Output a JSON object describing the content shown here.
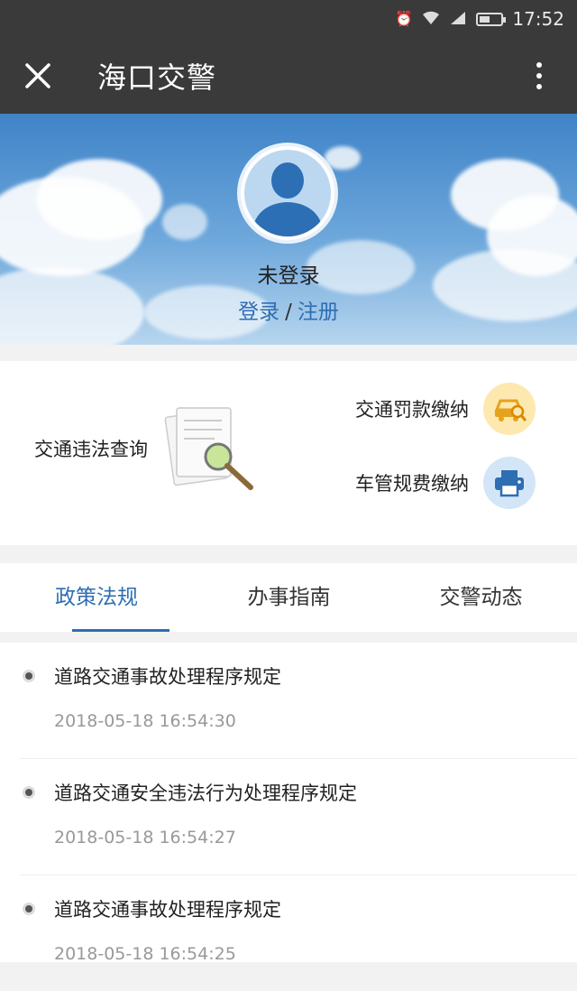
{
  "status_bar": {
    "time": "17:52",
    "battery_level": 0.5
  },
  "header": {
    "title": "海口交警"
  },
  "profile": {
    "status": "未登录",
    "login": "登录",
    "separator": "/",
    "register": "注册"
  },
  "services": {
    "violation_query": "交通违法查询",
    "traffic_fine": "交通罚款缴纳",
    "vehicle_fee": "车管规费缴纳"
  },
  "tabs": [
    "政策法规",
    "办事指南",
    "交警动态"
  ],
  "articles": [
    {
      "title": "道路交通事故处理程序规定",
      "time": "2018-05-18 16:54:30"
    },
    {
      "title": "道路交通安全违法行为处理程序规定",
      "time": "2018-05-18 16:54:27"
    },
    {
      "title": "道路交通事故处理程序规定",
      "time": "2018-05-18 16:54:25"
    }
  ],
  "colors": {
    "bar": "#3a3a3a",
    "accent": "#2e6eb2",
    "fine_icon_bg": "#fde8b0",
    "fee_icon_bg": "#d3e6f7"
  }
}
